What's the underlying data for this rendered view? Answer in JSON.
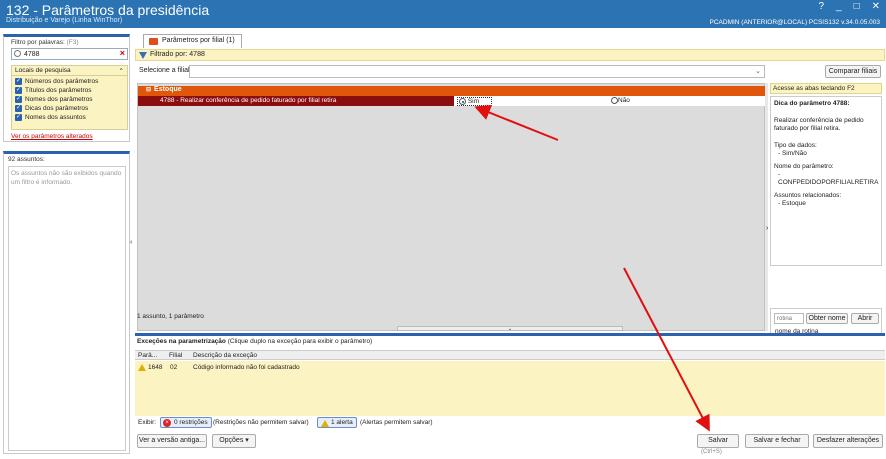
{
  "window": {
    "title": "132 - Parâmetros da presidência",
    "subtitle": "Distribuição e Varejo (Linha WinThor)",
    "user_info": "PCADMIN (ANTERIOR@LOCAL)  PCSIS132  v.34.0.05.003"
  },
  "left": {
    "filter_label": "Filtro por palavras:",
    "filter_shortcut": "(F3)",
    "search_value": "4788",
    "locais_title": "Locais de pesquisa",
    "locais": [
      "Números dos parâmetros",
      "Títulos dos parâmetros",
      "Nomes dos parâmetros",
      "Dicas dos parâmetros",
      "Nomes dos assuntos"
    ],
    "altered_link": "Ver os parâmetros alterados",
    "subjects_count": "92 assuntos:",
    "subjects_note": "Os assuntos não são exibidos quando um filtro é informado."
  },
  "main": {
    "tab_label": "Parâmetros por filial  (1)",
    "filter_text": "Filtrado por: 4788",
    "select_label": "Selecione a filial:",
    "compare_button": "Comparar filiais",
    "category": "Estoque",
    "param_label": "4788 - Realizar conferência de pedido faturado por filial retira",
    "opt_yes": "Sim",
    "opt_no": "Não",
    "status": "1 assunto, 1 parâmetro"
  },
  "tips": {
    "hint": "Acesse as abas teclando F2",
    "title": "Dica do parâmetro 4788:",
    "desc": "Realizar conferência de pedido faturado por filial retira.",
    "type_label": "Tipo de dados:",
    "type_value": "- Sim/Não",
    "name_label": "Nome do parâmetro:",
    "name_value": "- CONFPEDIDOPORFILIALRETIRA",
    "subj_label": "Assuntos relacionados:",
    "subj_value": "- Estoque",
    "routine_placeholder": "rotina",
    "get_name_button": "Obter nome",
    "open_button": "Abrir",
    "routine_name": "nome da rotina"
  },
  "exceptions": {
    "title": "Exceções na parametrização",
    "hint": "(Clique duplo na exceção para exibir o parâmetro)",
    "col_param": "Parâ...",
    "col_filial": "Filial",
    "col_desc": "Descrição da exceção",
    "row_param": "1648",
    "row_filial": "02",
    "row_desc": "Código informado não foi cadastrado",
    "show_label": "Exibir:",
    "restr_badge": "0 restrições",
    "restr_note": "(Restrições não permitem salvar)",
    "alert_badge": "1 alerta",
    "alert_note": "(Alertas permitem salvar)"
  },
  "footer": {
    "old_version": "Ver a versão antiga...",
    "options": "Opções",
    "save": "Salvar",
    "save_shortcut": "(Ctrl+S)",
    "save_close": "Salvar e fechar",
    "undo": "Desfazer alterações"
  }
}
